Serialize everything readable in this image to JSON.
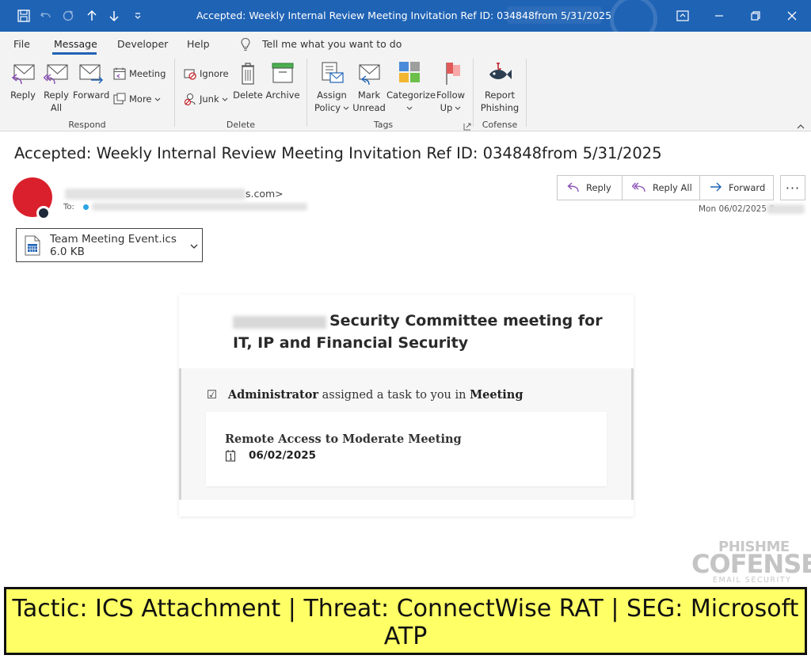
{
  "window": {
    "title": "Accepted: Weekly Internal Review Meeting Invitation Ref ID: 034848from 5/31/2025"
  },
  "menu": {
    "items": [
      "File",
      "Message",
      "Developer",
      "Help"
    ],
    "active": "Message",
    "tellme": "Tell me what you want to do"
  },
  "ribbon": {
    "respond": {
      "reply": "Reply",
      "reply_all_1": "Reply",
      "reply_all_2": "All",
      "forward": "Forward",
      "meeting": "Meeting",
      "more": "More",
      "label": "Respond"
    },
    "delete": {
      "ignore": "Ignore",
      "junk": "Junk",
      "delete": "Delete",
      "archive": "Archive",
      "label": "Delete"
    },
    "tags": {
      "assign_1": "Assign",
      "assign_2": "Policy",
      "mark_1": "Mark",
      "mark_2": "Unread",
      "categorize": "Categorize",
      "follow_1": "Follow",
      "follow_2": "Up",
      "label": "Tags"
    },
    "cofense": {
      "report_1": "Report",
      "report_2": "Phishing",
      "label": "Cofense"
    }
  },
  "message": {
    "subject": "Accepted: Weekly Internal Review Meeting Invitation Ref ID: 034848from 5/31/2025",
    "from_suffix": "s.com>",
    "to_label": "To:",
    "date": "Mon 06/02/2025 0",
    "actions": {
      "reply": "Reply",
      "reply_all": "Reply All",
      "forward": "Forward",
      "more": "···"
    },
    "attachment": {
      "name": "Team Meeting Event.ics",
      "size": "6.0 KB"
    }
  },
  "body": {
    "title": "Security Committee meeting for IT, IP and Financial Security",
    "assigner": "Administrator",
    "assign_text": " assigned a task to you in ",
    "assign_target": "Meeting",
    "checkbox": "☑",
    "task_title": "Remote Access to Moderate Meeting",
    "task_date": "06/02/2025"
  },
  "watermark": {
    "phishme": "PHISHME",
    "cofense": "COFENSE",
    "sub": "EMAIL SECURITY"
  },
  "banner": {
    "text": "Tactic: ICS Attachment | Threat: ConnectWise RAT | SEG: Microsoft ATP"
  },
  "colors": {
    "titlebar": "#1f63b5",
    "avatar": "#d9202c",
    "banner": "#ffff66"
  }
}
